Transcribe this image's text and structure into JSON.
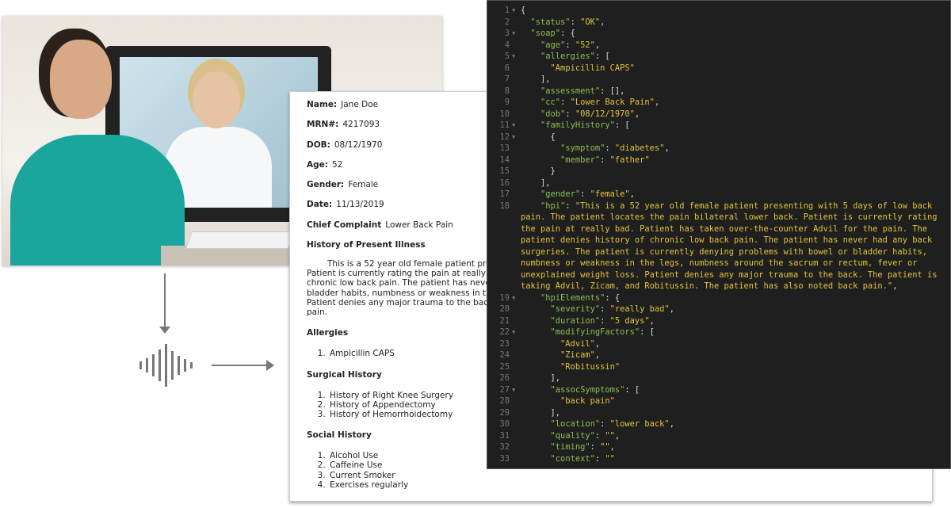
{
  "document": {
    "fields": [
      {
        "label": "Name:",
        "value": "Jane Doe"
      },
      {
        "label": "MRN#:",
        "value": "4217093"
      },
      {
        "label": "DOB:",
        "value": "08/12/1970"
      },
      {
        "label": "Age:",
        "value": "52"
      },
      {
        "label": "Gender:",
        "value": "Female"
      },
      {
        "label": "Date:",
        "value": "11/13/2019"
      },
      {
        "label": "Chief Complaint",
        "value": "Lower Back Pain"
      }
    ],
    "hpi_title": "History of Present Illness",
    "hpi_text": "This is a 52 year old female patient presenting with 5 days of low back pain. The patient locates the pain bilateral lower back. Patient is currently rating the pain at really bad. Patient has taken over-the-counter Advil for the pain. The patient denies history of chronic low back pain. The patient has never had any back surgeries. The patient is currently denying problems with bowel or bladder habits, numbness or weakness in the legs, numbness around the sacrum or rectum, fever or unexplained weight loss. Patient denies any major trauma to the back. The patient is taking Advil, Zicam, and Robitussin. The patient has also noted back pain.",
    "sections": [
      {
        "title": "Allergies",
        "items": [
          "Ampicillin CAPS"
        ]
      },
      {
        "title": "Surgical History",
        "items": [
          "History of Right Knee Surgery",
          "History of Appendectomy",
          "History of Hemorrhoidectomy"
        ]
      },
      {
        "title": "Social History",
        "items": [
          "Alcohol Use",
          "Caffeine Use",
          "Current Smoker",
          "Exercises regularly"
        ]
      },
      {
        "title": "Past Medical History",
        "items": []
      }
    ]
  },
  "code": {
    "colors": {
      "key": "#8cc04f",
      "string": "#e3c43a",
      "background": "#1f1f1f"
    },
    "lines": [
      {
        "n": "1",
        "fold": true,
        "t": [
          [
            "p",
            "{"
          ]
        ]
      },
      {
        "n": "2",
        "t": [
          [
            "p",
            "  "
          ],
          [
            "k",
            "\"status\""
          ],
          [
            "p",
            ": "
          ],
          [
            "s",
            "\"OK\""
          ],
          [
            "p",
            ","
          ]
        ]
      },
      {
        "n": "3",
        "fold": true,
        "t": [
          [
            "p",
            "  "
          ],
          [
            "k",
            "\"soap\""
          ],
          [
            "p",
            ": {"
          ]
        ]
      },
      {
        "n": "4",
        "t": [
          [
            "p",
            "    "
          ],
          [
            "k",
            "\"age\""
          ],
          [
            "p",
            ": "
          ],
          [
            "s",
            "\"52\""
          ],
          [
            "p",
            ","
          ]
        ]
      },
      {
        "n": "5",
        "fold": true,
        "t": [
          [
            "p",
            "    "
          ],
          [
            "k",
            "\"allergies\""
          ],
          [
            "p",
            ": ["
          ]
        ]
      },
      {
        "n": "6",
        "t": [
          [
            "p",
            "      "
          ],
          [
            "s",
            "\"Ampicillin CAPS\""
          ]
        ]
      },
      {
        "n": "7",
        "t": [
          [
            "p",
            "    ],"
          ]
        ]
      },
      {
        "n": "8",
        "t": [
          [
            "p",
            "    "
          ],
          [
            "k",
            "\"assessment\""
          ],
          [
            "p",
            ": [],"
          ]
        ]
      },
      {
        "n": "9",
        "t": [
          [
            "p",
            "    "
          ],
          [
            "k",
            "\"cc\""
          ],
          [
            "p",
            ": "
          ],
          [
            "s",
            "\"Lower Back Pain\""
          ],
          [
            "p",
            ","
          ]
        ]
      },
      {
        "n": "10",
        "t": [
          [
            "p",
            "    "
          ],
          [
            "k",
            "\"dob\""
          ],
          [
            "p",
            ": "
          ],
          [
            "s",
            "\"08/12/1970\""
          ],
          [
            "p",
            ","
          ]
        ]
      },
      {
        "n": "11",
        "fold": true,
        "t": [
          [
            "p",
            "    "
          ],
          [
            "k",
            "\"familyHistory\""
          ],
          [
            "p",
            ": ["
          ]
        ]
      },
      {
        "n": "12",
        "fold": true,
        "t": [
          [
            "p",
            "      {"
          ]
        ]
      },
      {
        "n": "13",
        "t": [
          [
            "p",
            "        "
          ],
          [
            "k",
            "\"symptom\""
          ],
          [
            "p",
            ": "
          ],
          [
            "s",
            "\"diabetes\""
          ],
          [
            "p",
            ","
          ]
        ]
      },
      {
        "n": "14",
        "t": [
          [
            "p",
            "        "
          ],
          [
            "k",
            "\"member\""
          ],
          [
            "p",
            ": "
          ],
          [
            "s",
            "\"father\""
          ]
        ]
      },
      {
        "n": "15",
        "t": [
          [
            "p",
            "      }"
          ]
        ]
      },
      {
        "n": "16",
        "t": [
          [
            "p",
            "    ],"
          ]
        ]
      },
      {
        "n": "17",
        "t": [
          [
            "p",
            "    "
          ],
          [
            "k",
            "\"gender\""
          ],
          [
            "p",
            ": "
          ],
          [
            "s",
            "\"female\""
          ],
          [
            "p",
            ","
          ]
        ]
      },
      {
        "n": "18",
        "t": [
          [
            "p",
            "    "
          ],
          [
            "k",
            "\"hpi\""
          ],
          [
            "p",
            ": "
          ],
          [
            "s",
            "\"This is a 52 year old female patient presenting with 5 days of low back pain. The patient locates the pain bilateral lower back. Patient is currently rating the pain at really bad. Patient has taken over-the-counter Advil for the pain. The patient denies history of chronic low back pain. The patient has never had any back surgeries. The patient is currently denying problems with bowel or bladder habits, numbness or weakness in the legs, numbness around the sacrum or rectum, fever or unexplained weight loss. Patient denies any major trauma to the back. The patient is taking Advil, Zicam, and Robitussin. The patient has also noted back pain.\""
          ],
          [
            "p",
            ","
          ]
        ]
      },
      {
        "n": "19",
        "fold": true,
        "t": [
          [
            "p",
            "    "
          ],
          [
            "k",
            "\"hpiElements\""
          ],
          [
            "p",
            ": {"
          ]
        ]
      },
      {
        "n": "20",
        "t": [
          [
            "p",
            "      "
          ],
          [
            "k",
            "\"severity\""
          ],
          [
            "p",
            ": "
          ],
          [
            "s",
            "\"really bad\""
          ],
          [
            "p",
            ","
          ]
        ]
      },
      {
        "n": "21",
        "t": [
          [
            "p",
            "      "
          ],
          [
            "k",
            "\"duration\""
          ],
          [
            "p",
            ": "
          ],
          [
            "s",
            "\"5 days\""
          ],
          [
            "p",
            ","
          ]
        ]
      },
      {
        "n": "22",
        "fold": true,
        "t": [
          [
            "p",
            "      "
          ],
          [
            "k",
            "\"modifyingFactors\""
          ],
          [
            "p",
            ": ["
          ]
        ]
      },
      {
        "n": "23",
        "t": [
          [
            "p",
            "        "
          ],
          [
            "s",
            "\"Advil\""
          ],
          [
            "p",
            ","
          ]
        ]
      },
      {
        "n": "24",
        "t": [
          [
            "p",
            "        "
          ],
          [
            "s",
            "\"Zicam\""
          ],
          [
            "p",
            ","
          ]
        ]
      },
      {
        "n": "25",
        "t": [
          [
            "p",
            "        "
          ],
          [
            "s",
            "\"Robitussin\""
          ]
        ]
      },
      {
        "n": "26",
        "t": [
          [
            "p",
            "      ],"
          ]
        ]
      },
      {
        "n": "27",
        "fold": true,
        "t": [
          [
            "p",
            "      "
          ],
          [
            "k",
            "\"assocSymptoms\""
          ],
          [
            "p",
            ": ["
          ]
        ]
      },
      {
        "n": "28",
        "t": [
          [
            "p",
            "        "
          ],
          [
            "s",
            "\"back pain\""
          ]
        ]
      },
      {
        "n": "29",
        "t": [
          [
            "p",
            "      ],"
          ]
        ]
      },
      {
        "n": "30",
        "t": [
          [
            "p",
            "      "
          ],
          [
            "k",
            "\"location\""
          ],
          [
            "p",
            ": "
          ],
          [
            "s",
            "\"lower back\""
          ],
          [
            "p",
            ","
          ]
        ]
      },
      {
        "n": "31",
        "t": [
          [
            "p",
            "      "
          ],
          [
            "k",
            "\"quality\""
          ],
          [
            "p",
            ": "
          ],
          [
            "s",
            "\"\""
          ],
          [
            "p",
            ","
          ]
        ]
      },
      {
        "n": "32",
        "t": [
          [
            "p",
            "      "
          ],
          [
            "k",
            "\"timing\""
          ],
          [
            "p",
            ": "
          ],
          [
            "s",
            "\"\""
          ],
          [
            "p",
            ","
          ]
        ]
      },
      {
        "n": "33",
        "t": [
          [
            "p",
            "      "
          ],
          [
            "k",
            "\"context\""
          ],
          [
            "p",
            ": "
          ],
          [
            "s",
            "\"\""
          ]
        ]
      }
    ]
  }
}
